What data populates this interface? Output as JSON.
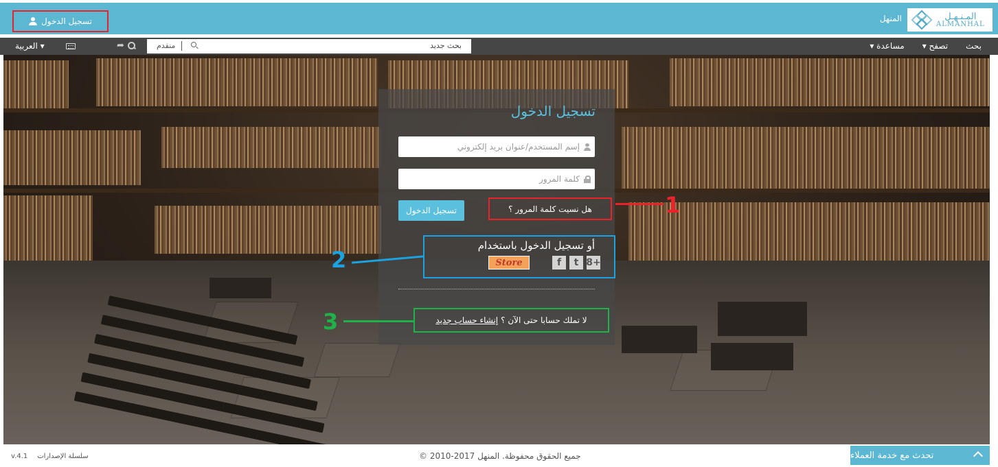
{
  "header": {
    "login_label": "تسجيل الدخول",
    "brand_label": "المنهل",
    "logo_ar": "المـنـهـل",
    "logo_en": "ALMANHAL"
  },
  "nav": {
    "language": "العربية ▾",
    "advanced": "منقدم",
    "new_search": "بحث جديد",
    "search": "بحث",
    "browse": "تصفح ▾",
    "help": "مساعدة ▾"
  },
  "login_form": {
    "title": "تسجيل الدخول",
    "username_placeholder": "إسم المستخدم/عنوان بريد إلكتروني",
    "password_placeholder": "كلمة المرور",
    "submit": "تسجيل الدخول",
    "forgot": "هل نسيت كلمة المرور ؟",
    "social_title": "أو تسجيل الدخول باستخدام",
    "store_label": "Store",
    "google_label": "8+",
    "twitter_label": "t",
    "facebook_label": "f",
    "no_account": "لا تملك حسابا حتى الآن ؟",
    "create_account": "إنشاء حساب جديد"
  },
  "callouts": {
    "one": "1",
    "two": "2",
    "three": "3",
    "color_one": "#e8232a",
    "color_two": "#1ba2e0",
    "color_three": "#1fb14a"
  },
  "footer": {
    "version_label": "سلسلة الإصدارات",
    "version": "v.4.1",
    "copyright": "جميع الحقوق محفوظة. المنهل 2017-2010 ©",
    "chat": "تحدث مع خدمة العملاء"
  },
  "colors": {
    "accent": "#5bb7d2",
    "navbar": "#464646"
  }
}
